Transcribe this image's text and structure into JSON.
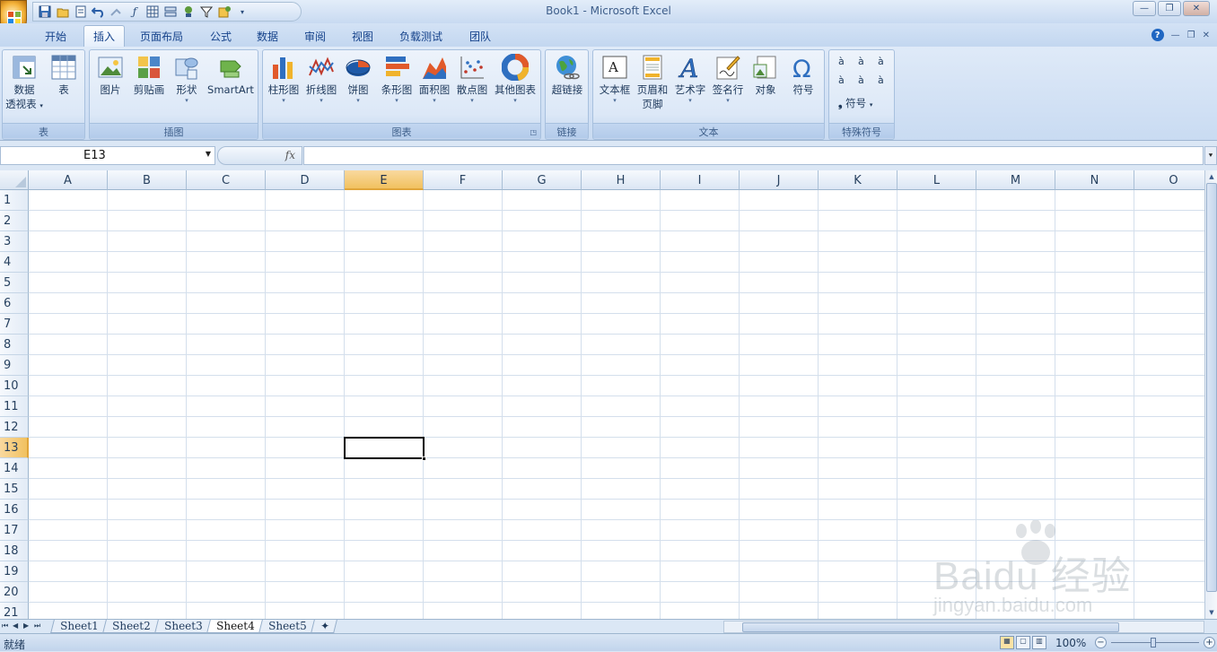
{
  "window": {
    "title": "Book1 - Microsoft Excel"
  },
  "qat": {
    "icons": [
      "save-icon",
      "open-icon",
      "print-preview-icon",
      "undo-icon",
      "redo-icon",
      "function-icon",
      "table-icon",
      "align-icon",
      "connect-icon",
      "filter-icon",
      "macro-icon",
      "customize-icon"
    ]
  },
  "tabs": [
    "开始",
    "插入",
    "页面布局",
    "公式",
    "数据",
    "审阅",
    "视图",
    "负载测试",
    "团队"
  ],
  "active_tab": "插入",
  "ribbon": {
    "groups": {
      "tables": {
        "label": "表",
        "pivot_line1": "数据",
        "pivot_line2": "透视表",
        "table": "表"
      },
      "illustrations": {
        "label": "插图",
        "picture": "图片",
        "clipart": "剪贴画",
        "shapes": "形状",
        "smartart": "SmartArt"
      },
      "charts": {
        "label": "图表",
        "column": "柱形图",
        "line": "折线图",
        "pie": "饼图",
        "bar": "条形图",
        "area": "面积图",
        "scatter": "散点图",
        "other": "其他图表"
      },
      "links": {
        "label": "链接",
        "hyperlink": "超链接"
      },
      "text": {
        "label": "文本",
        "textbox": "文本框",
        "header_line1": "页眉和",
        "header_line2": "页脚",
        "wordart": "艺术字",
        "signature": "签名行",
        "object": "对象",
        "symbol": "符号"
      },
      "special": {
        "label": "特殊符号",
        "symbols": [
          "à",
          "à",
          "à",
          "à",
          "à",
          "à"
        ],
        "symbol_btn": "符号"
      }
    }
  },
  "formula_bar": {
    "name_box": "E13",
    "fx": "fx",
    "value": ""
  },
  "grid": {
    "columns": [
      "A",
      "B",
      "C",
      "D",
      "E",
      "F",
      "G",
      "H",
      "I",
      "J",
      "K",
      "L",
      "M",
      "N",
      "O"
    ],
    "rows": [
      "1",
      "2",
      "3",
      "4",
      "5",
      "6",
      "7",
      "8",
      "9",
      "10",
      "11",
      "12",
      "13",
      "14",
      "15",
      "16",
      "17",
      "18",
      "19",
      "20",
      "21"
    ],
    "selected_column": "E",
    "selected_row": "13"
  },
  "sheets": [
    "Sheet1",
    "Sheet2",
    "Sheet3",
    "Sheet4",
    "Sheet5"
  ],
  "active_sheet": "Sheet4",
  "status": {
    "text": "就绪",
    "zoom": "100%"
  },
  "watermark": {
    "big": "Baidu 经验",
    "small": "jingyan.baidu.com"
  }
}
